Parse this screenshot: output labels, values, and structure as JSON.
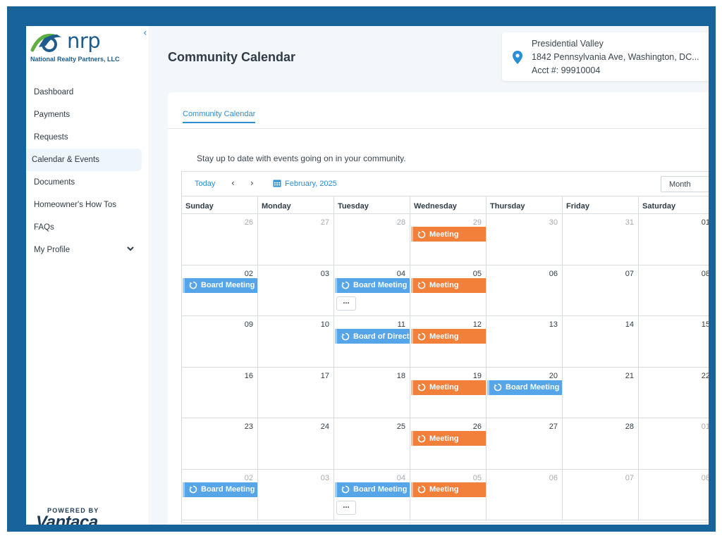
{
  "brand": {
    "logo_word": "nrp",
    "logo_subtitle": "National Realty Partners, LLC",
    "powered_by": "POWERED BY",
    "powered_word": "Vantaca"
  },
  "sidebar": {
    "collapse_icon": "chevron-left-icon",
    "items": [
      {
        "label": "Dashboard"
      },
      {
        "label": "Payments"
      },
      {
        "label": "Requests"
      },
      {
        "label": "Calendar & Events",
        "active": true
      },
      {
        "label": "Documents"
      },
      {
        "label": "Homeowner's How Tos"
      },
      {
        "label": "FAQs"
      },
      {
        "label": "My Profile",
        "expandable": true
      }
    ]
  },
  "header": {
    "title": "Community Calendar",
    "location": {
      "name": "Presidential Valley",
      "address": "1842 Pennsylvania Ave, Washington, DC...",
      "account": "Acct #: 99910004",
      "icon": "map-pin-icon"
    }
  },
  "tabs": [
    {
      "label": "Community Calendar",
      "active": true
    }
  ],
  "intro": "Stay up to date with events going on in your community.",
  "calendar": {
    "today_label": "Today",
    "prev_icon": "chevron-left-icon",
    "next_icon": "chevron-right-icon",
    "period": "February, 2025",
    "view": "Month",
    "day_names": [
      "Sunday",
      "Monday",
      "Tuesday",
      "Wednesday",
      "Thursday",
      "Friday",
      "Saturday"
    ],
    "weeks": [
      {
        "days": [
          {
            "num": "26",
            "other": true
          },
          {
            "num": "27",
            "other": true
          },
          {
            "num": "28",
            "other": true
          },
          {
            "num": "29",
            "other": true,
            "events": [
              {
                "title": "Meeting",
                "color": "orange"
              }
            ]
          },
          {
            "num": "30",
            "other": true
          },
          {
            "num": "31",
            "other": true
          },
          {
            "num": "01"
          }
        ]
      },
      {
        "days": [
          {
            "num": "02",
            "events": [
              {
                "title": "Board Meeting",
                "color": "blue"
              }
            ]
          },
          {
            "num": "03"
          },
          {
            "num": "04",
            "events": [
              {
                "title": "Board Meeting",
                "color": "blue"
              }
            ],
            "more": "..."
          },
          {
            "num": "05",
            "events": [
              {
                "title": "Meeting",
                "color": "orange"
              }
            ]
          },
          {
            "num": "06"
          },
          {
            "num": "07"
          },
          {
            "num": "08"
          }
        ]
      },
      {
        "days": [
          {
            "num": "09"
          },
          {
            "num": "10"
          },
          {
            "num": "11",
            "events": [
              {
                "title": "Board of Direct",
                "color": "blue"
              }
            ]
          },
          {
            "num": "12",
            "events": [
              {
                "title": "Meeting",
                "color": "orange"
              }
            ]
          },
          {
            "num": "13"
          },
          {
            "num": "14"
          },
          {
            "num": "15"
          }
        ]
      },
      {
        "days": [
          {
            "num": "16"
          },
          {
            "num": "17"
          },
          {
            "num": "18"
          },
          {
            "num": "19",
            "events": [
              {
                "title": "Meeting",
                "color": "orange"
              }
            ]
          },
          {
            "num": "20",
            "events": [
              {
                "title": "Board Meeting",
                "color": "blue"
              }
            ]
          },
          {
            "num": "21"
          },
          {
            "num": "22"
          }
        ]
      },
      {
        "days": [
          {
            "num": "23"
          },
          {
            "num": "24"
          },
          {
            "num": "25"
          },
          {
            "num": "26",
            "events": [
              {
                "title": "Meeting",
                "color": "orange"
              }
            ]
          },
          {
            "num": "27"
          },
          {
            "num": "28"
          },
          {
            "num": "01",
            "other": true
          }
        ]
      },
      {
        "days": [
          {
            "num": "02",
            "other": true,
            "events": [
              {
                "title": "Board Meeting",
                "color": "blue"
              }
            ]
          },
          {
            "num": "03",
            "other": true
          },
          {
            "num": "04",
            "other": true,
            "events": [
              {
                "title": "Board Meeting",
                "color": "blue"
              }
            ],
            "more": "..."
          },
          {
            "num": "05",
            "other": true,
            "events": [
              {
                "title": "Meeting",
                "color": "orange"
              }
            ]
          },
          {
            "num": "06",
            "other": true
          },
          {
            "num": "07",
            "other": true
          },
          {
            "num": "08",
            "other": true
          }
        ]
      }
    ]
  },
  "colors": {
    "frame": "#17639a",
    "accent": "#2b8fd6",
    "event_blue": "#55a5e8",
    "event_orange": "#f27f3a"
  }
}
